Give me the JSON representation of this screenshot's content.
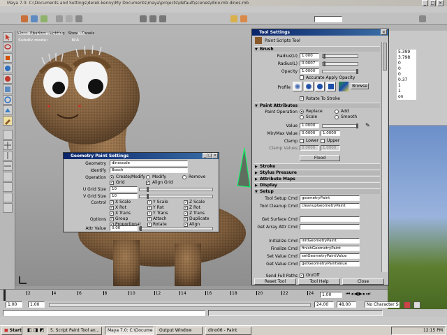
{
  "window": {
    "title": "Maya 7.0: C:\\Documents and Settings\\derek.kenny\\My Documents\\maya\\projects\\default\\scenes\\dino.mb    dinos.mb"
  },
  "viewport": {
    "hud": [
      {
        "label": "Subdiv current level:",
        "value": "N/A"
      },
      {
        "label": "Subdiv mode:",
        "value": "N/A"
      }
    ],
    "menu": [
      "View",
      "Shading",
      "Lighting",
      "Show",
      "Panels"
    ]
  },
  "channel_box": {
    "values": [
      "5.399",
      "3.798",
      "0",
      "0",
      "0",
      "0.37",
      "1",
      "1",
      "on"
    ]
  },
  "tool_settings": {
    "title": "Tool Settings",
    "tool_name": "Paint Scripts Tool",
    "brush_section": "Brush",
    "fields": {
      "radius_u": {
        "label": "Radius(U)",
        "value": "1.000"
      },
      "radius_l": {
        "label": "Radius(L)",
        "value": "0.0007"
      },
      "opacity": {
        "label": "Opacity",
        "value": "1.0000"
      }
    },
    "accurate_apply": "Accurate Apply Opacity",
    "profile_label": "Profile",
    "browse_label": "Browse",
    "rotate_to_stroke": "Rotate To Stroke",
    "paint_attributes": {
      "header": "Paint Attributes",
      "operation_label": "Paint Operation",
      "operations": [
        "Replace",
        "Add",
        "Scale",
        "Smooth"
      ],
      "value": {
        "label": "Value",
        "value": "1.0000"
      },
      "minmax": {
        "label": "Min/Max Value",
        "min": "0.0000",
        "max": "1.0000"
      },
      "clamp": {
        "label": "Clamp",
        "lower": "Lower",
        "upper": "Upper"
      },
      "clamp_values": {
        "label": "Clamp Values",
        "min": "0.0000",
        "max": "1.0000"
      },
      "flood": "Flood"
    },
    "collapsed_sections": [
      "Stroke",
      "Stylus Pressure",
      "Attribute Maps",
      "Display"
    ],
    "setup": {
      "header": "Setup",
      "rows": [
        {
          "label": "Tool Setup Cmd",
          "value": "geometryPaint"
        },
        {
          "label": "Tool Cleanup Cmd",
          "value": "cleanupGeometryPaint"
        },
        {
          "label": "Get Surface Cmd",
          "value": ""
        },
        {
          "label": "Get Array Attr Cmd",
          "value": ""
        },
        {
          "label": "Initialize Cmd",
          "value": "initGeometryPaint"
        },
        {
          "label": "Finalize Cmd",
          "value": "finishGeometryPaint"
        },
        {
          "label": "Set Value Cmd",
          "value": "setGeometryPaintValue"
        },
        {
          "label": "Get Value Cmd",
          "value": "getGeometryPaintValue"
        }
      ],
      "send_full_paths_label": "Send Full Paths",
      "send_full_paths_value": "On/Off"
    },
    "buttons": [
      "Reset Tool",
      "Tool Help",
      "Close"
    ]
  },
  "geometry_paint": {
    "title": "Geometry Paint Settings",
    "geometry": {
      "label": "Geometry",
      "value": "dinoscale"
    },
    "bead": {
      "label": "Identify",
      "value": "Bosch"
    },
    "operation": {
      "label": "Operation",
      "options": [
        "Create/Modify",
        "Modify",
        "Remove"
      ]
    },
    "grid_label": "Grid",
    "align_grid": "Align Grid",
    "u_grid": {
      "label": "U Grid Size",
      "value": "10"
    },
    "v_grid": {
      "label": "V Grid Size",
      "value": "10"
    },
    "control": {
      "label": "Control",
      "checks": [
        "X Scale",
        "Y Scale",
        "Z Scale",
        "X Rot",
        "Y Rot",
        "Z Rot",
        "X Trans",
        "Y Trans",
        "Z Trans"
      ]
    },
    "options": {
      "label": "Options",
      "checks": [
        "Group",
        "Proportional",
        "Attach",
        "Duplicate",
        "Rotate",
        "Align"
      ]
    },
    "attr_value": {
      "label": "Attr Value",
      "value": "0.00"
    }
  },
  "timeline": {
    "ticks": [
      "2",
      "4",
      "6",
      "8",
      "10",
      "12",
      "14",
      "16",
      "18",
      "20",
      "22",
      "24"
    ],
    "current_frame": "1.00",
    "range_start": "1.00",
    "range_inner": "1.00",
    "range_end": "24.00",
    "range_end2": "48.00",
    "character_set": "No Character Set"
  },
  "taskbar": {
    "start": "Start",
    "tasks": [
      "5. Script Paint Tool an...",
      "Maya 7.0: C:\\Documents...",
      "Output Window",
      "dino06 - Paint"
    ],
    "clock": "12:15 PM"
  },
  "colors": {
    "title_active": "#0a246a",
    "viewport_bg": "#a6a6a6",
    "panel": "#c4c4c4"
  }
}
